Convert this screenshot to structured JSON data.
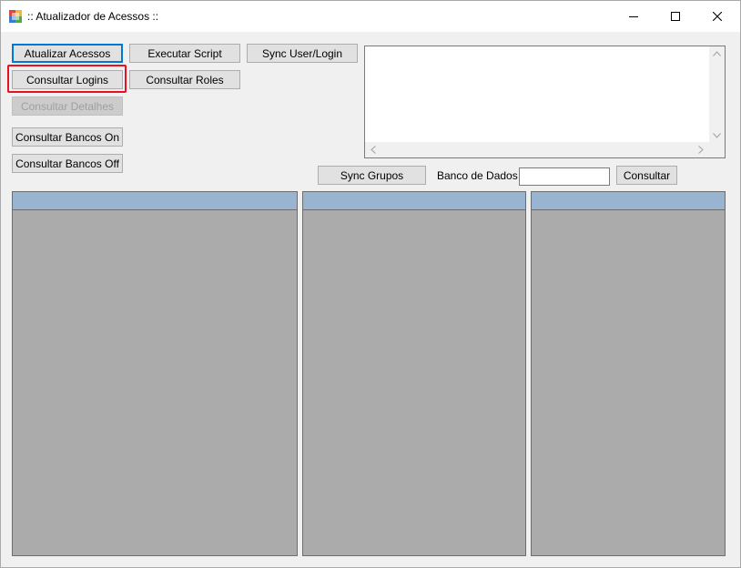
{
  "window": {
    "title": ":: Atualizador de Acessos ::",
    "icon": "app-window-icon",
    "controls": [
      "minimize-icon",
      "maximize-icon",
      "close-icon"
    ]
  },
  "buttons": {
    "atualizar_acessos": "Atualizar Acessos",
    "executar_script": "Executar Script",
    "sync_user_login": "Sync User/Login",
    "consultar_logins": "Consultar Logins",
    "consultar_roles": "Consultar Roles",
    "consultar_detalhes": "Consultar Detalhes",
    "consultar_bancos_on": "Consultar Bancos On",
    "consultar_bancos_off": "Consultar Bancos Off",
    "sync_grupos": "Sync Grupos",
    "consultar": "Consultar"
  },
  "database_filter": {
    "label": "Banco de Dados",
    "value": ""
  },
  "output_box": {
    "value": ""
  },
  "colors": {
    "highlight": "#e81123",
    "grid_header": "#99b4d1",
    "grid_background": "#ababab",
    "default_button_border": "#0078d7"
  }
}
